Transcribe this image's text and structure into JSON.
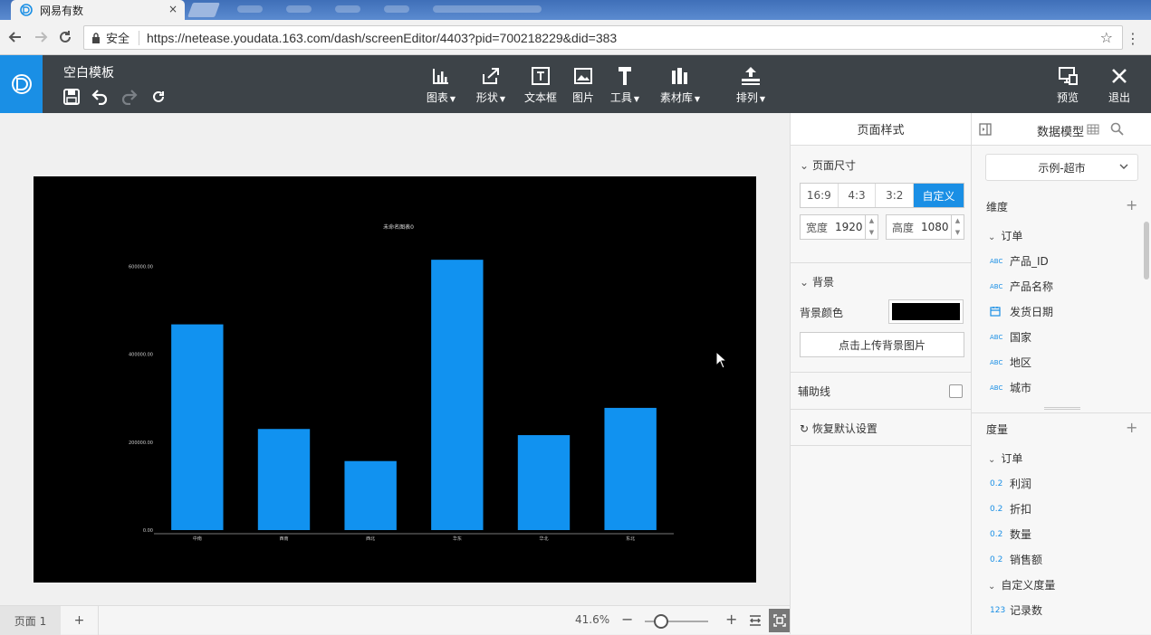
{
  "browser": {
    "tab_title": "网易有数",
    "tab_close": "×",
    "secure_label": "安全",
    "url": "https://netease.youdata.163.com/dash/screenEditor/4403?pid=700218229&did=383"
  },
  "toolbar": {
    "doc_title": "空白模板",
    "tools": [
      {
        "label": "图表",
        "icon": "bar-chart-icon",
        "dropdown": true
      },
      {
        "label": "形状",
        "icon": "shape-icon",
        "dropdown": true
      },
      {
        "label": "文本框",
        "icon": "textbox-icon",
        "dropdown": false
      },
      {
        "label": "图片",
        "icon": "image-icon",
        "dropdown": false
      },
      {
        "label": "工具",
        "icon": "tool-icon",
        "dropdown": true
      },
      {
        "label": "素材库",
        "icon": "library-icon",
        "dropdown": true
      },
      {
        "label": "排列",
        "icon": "arrange-icon",
        "dropdown": true
      }
    ],
    "preview_label": "预览",
    "exit_label": "退出"
  },
  "chart_data": {
    "type": "bar",
    "title": "未命名图表0",
    "categories": [
      "中南",
      "西南",
      "西北",
      "华东",
      "华北",
      "东北"
    ],
    "values": [
      468000,
      230000,
      157000,
      615000,
      216000,
      278000
    ],
    "ylim": [
      0,
      640000
    ],
    "yticks": [
      "0.00",
      "200000.00",
      "400000.00",
      "600000.00"
    ],
    "ytick_values": [
      0,
      200000,
      400000,
      600000
    ],
    "bar_color": "#1192f0",
    "background": "#000000",
    "grid": false
  },
  "bottom": {
    "page_tab": "页面 1",
    "add_page": "+",
    "zoom": "41.6%",
    "zoom_level": 0.25
  },
  "style_panel": {
    "title": "页面样式",
    "page_size_label": "页面尺寸",
    "ratios": [
      "16:9",
      "4:3",
      "3:2",
      "自定义"
    ],
    "active_ratio": "自定义",
    "width_label": "宽度",
    "width_value": "1920",
    "height_label": "高度",
    "height_value": "1080",
    "background_label": "背景",
    "bg_color_label": "背景颜色",
    "bg_color": "#000000",
    "upload_bg_label": "点击上传背景图片",
    "guides_label": "辅助线",
    "restore_label": "恢复默认设置"
  },
  "data_panel": {
    "title": "数据模型",
    "dataset": "示例-超市",
    "dimensions_label": "维度",
    "dim_group": "订单",
    "dimensions": [
      {
        "type": "ABC",
        "name": "产品_ID"
      },
      {
        "type": "ABC",
        "name": "产品名称"
      },
      {
        "type": "date",
        "name": "发货日期"
      },
      {
        "type": "ABC",
        "name": "国家"
      },
      {
        "type": "ABC",
        "name": "地区"
      },
      {
        "type": "ABC",
        "name": "城市"
      }
    ],
    "measures_label": "度量",
    "measure_group": "订单",
    "measures": [
      {
        "type": "0.2",
        "name": "利润"
      },
      {
        "type": "0.2",
        "name": "折扣"
      },
      {
        "type": "0.2",
        "name": "数量"
      },
      {
        "type": "0.2",
        "name": "销售额"
      }
    ],
    "custom_group": "自定义度量",
    "custom_measures": [
      {
        "type": "123",
        "name": "记录数"
      }
    ]
  }
}
